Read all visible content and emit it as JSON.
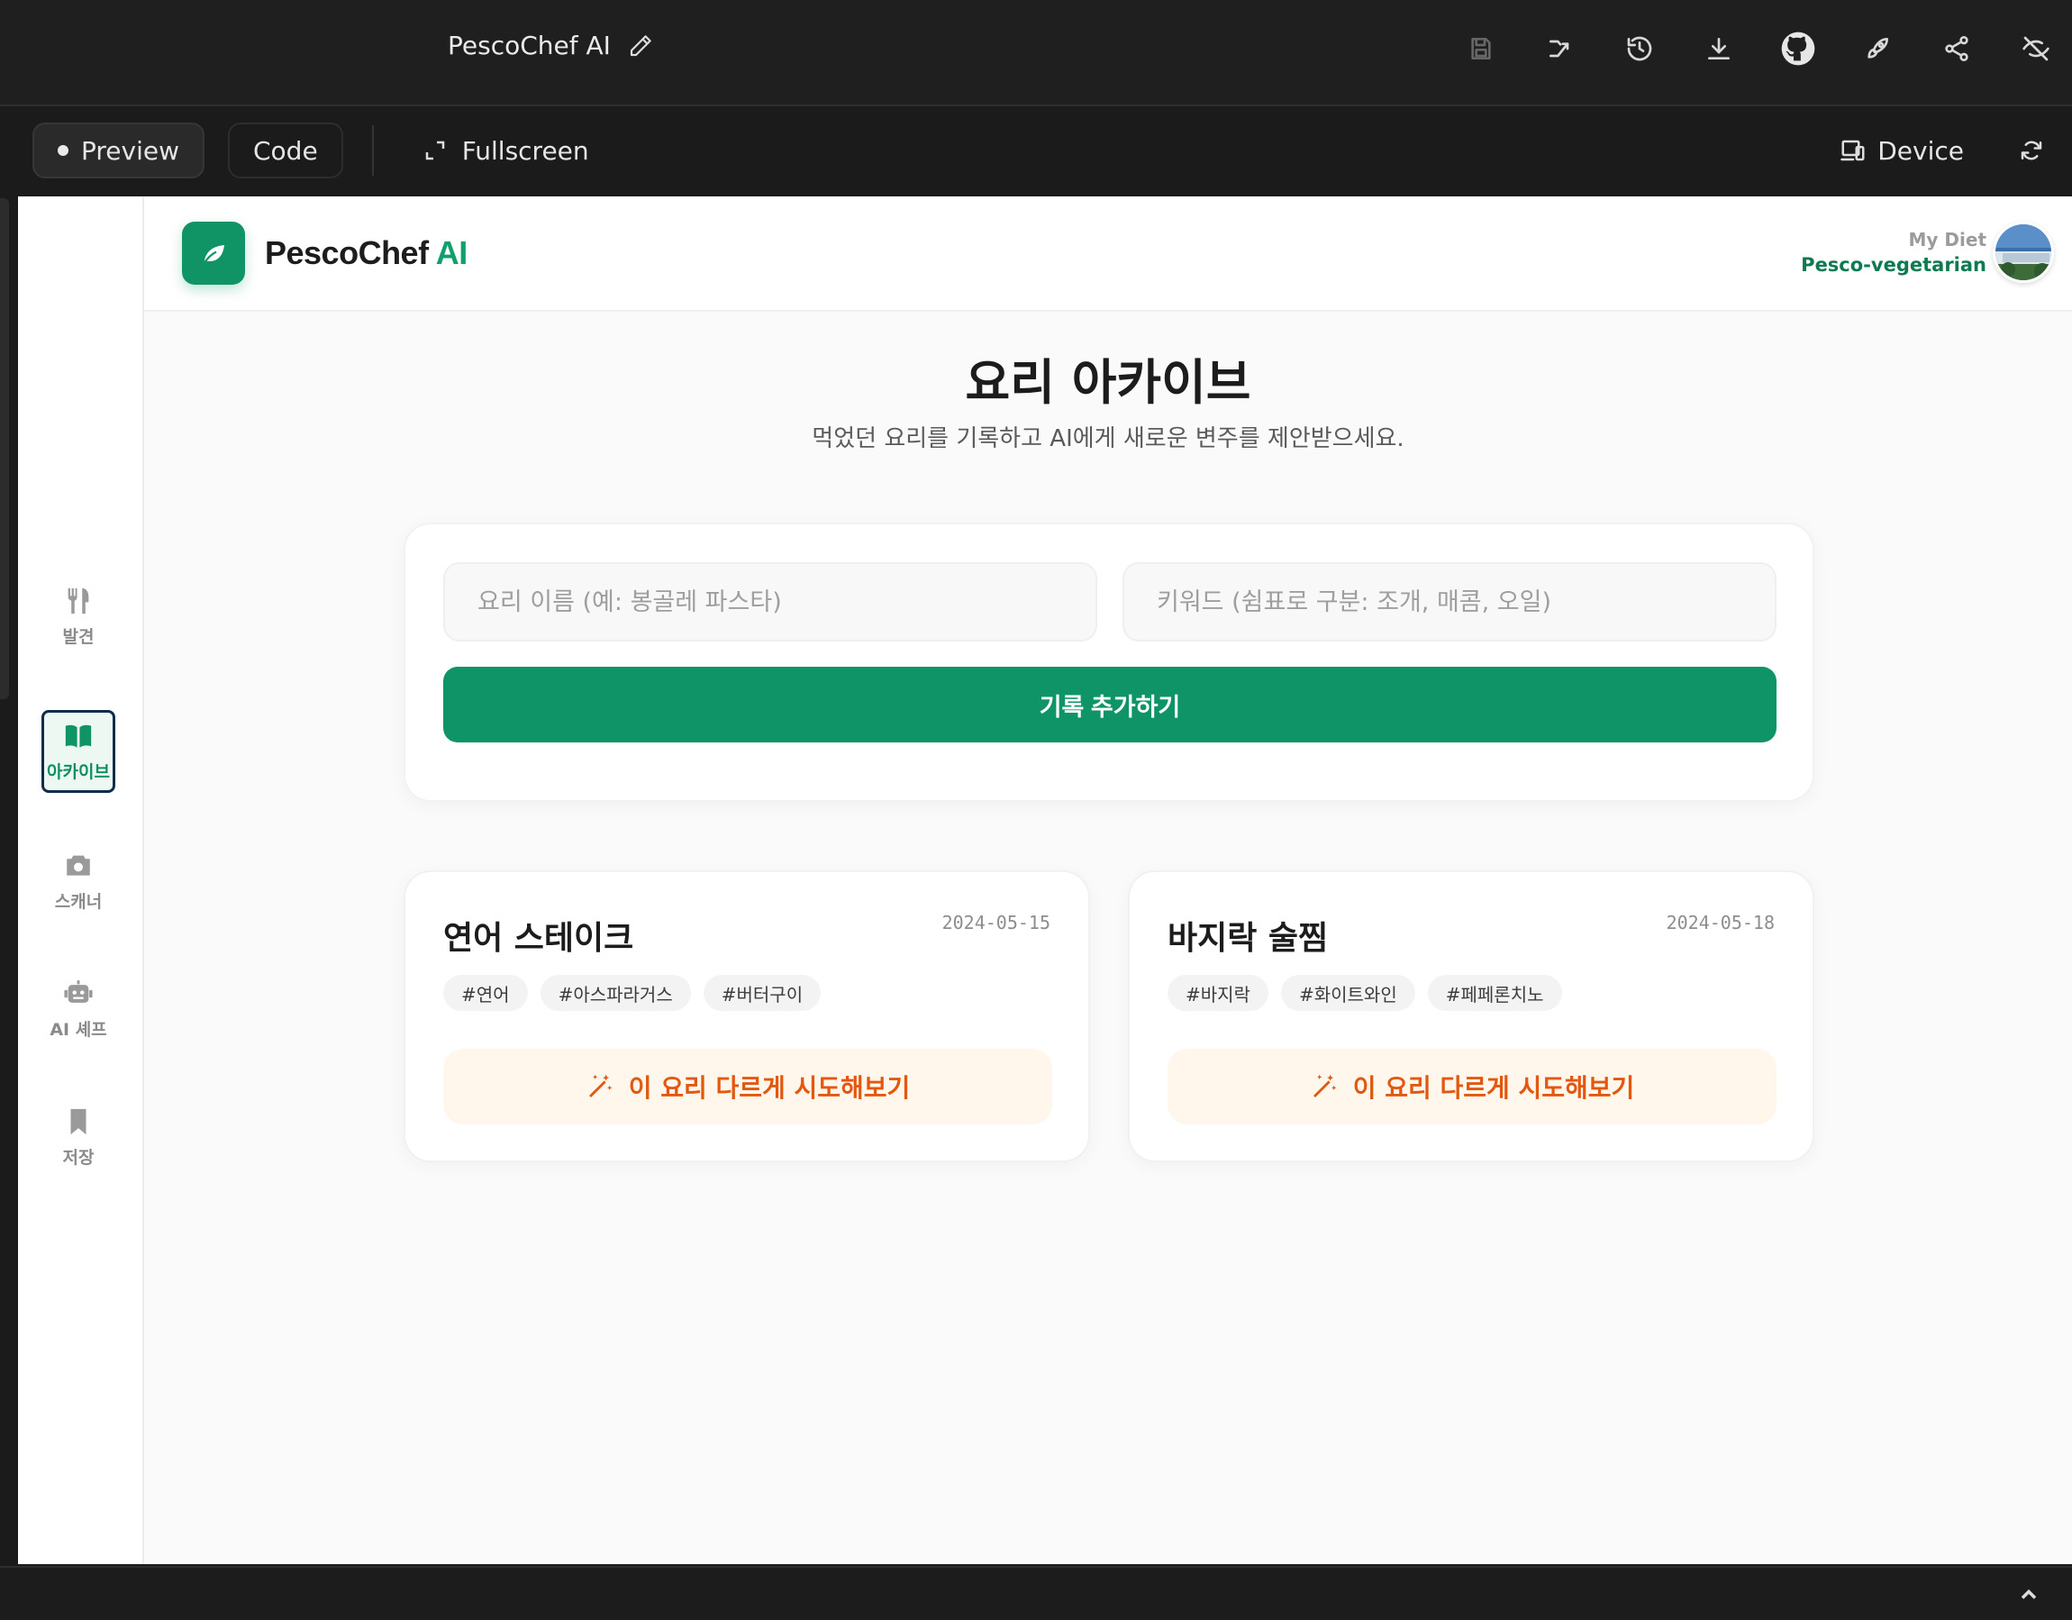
{
  "window": {
    "project_title": "PescoChef AI"
  },
  "toolbar": {
    "preview_label": "Preview",
    "code_label": "Code",
    "fullscreen_label": "Fullscreen",
    "device_label": "Device"
  },
  "app": {
    "brand_name": "PescoChef",
    "brand_suffix": "AI",
    "diet_label": "My Diet",
    "diet_value": "Pesco-vegetarian",
    "nav": [
      {
        "label": "발견",
        "icon": "fork-knife-icon"
      },
      {
        "label": "아카이브",
        "icon": "book-icon",
        "active": true
      },
      {
        "label": "스캐너",
        "icon": "camera-icon"
      },
      {
        "label": "AI 셰프",
        "icon": "robot-icon"
      },
      {
        "label": "저장",
        "icon": "bookmark-icon"
      }
    ]
  },
  "main": {
    "title": "요리 아카이브",
    "subtitle": "먹었던 요리를 기록하고 AI에게 새로운 변주를 제안받으세요.",
    "dish_placeholder": "요리 이름 (예: 봉골레 파스타)",
    "keyword_placeholder": "키워드 (쉼표로 구분: 조개, 매콤, 오일)",
    "add_button": "기록 추가하기",
    "try_label": "이 요리 다르게 시도해보기",
    "records": [
      {
        "title": "연어 스테이크",
        "date": "2024-05-15",
        "tags": [
          "#연어",
          "#아스파라거스",
          "#버터구이"
        ]
      },
      {
        "title": "바지락 술찜",
        "date": "2024-05-18",
        "tags": [
          "#바지락",
          "#화이트와인",
          "#페페론치노"
        ]
      }
    ]
  },
  "colors": {
    "accent": "#0e9466",
    "accent_text": "#0e7a52",
    "try_text": "#e3580f",
    "try_bg": "#fff6ec"
  }
}
